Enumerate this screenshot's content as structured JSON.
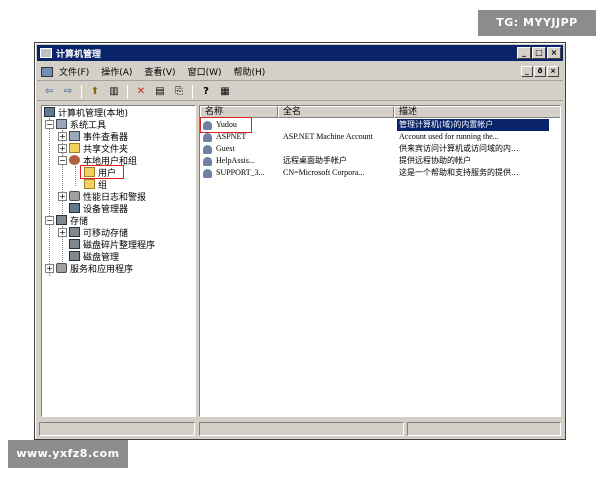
{
  "watermark_top": "TG: MYYJJPP",
  "watermark_bottom": "www.yxfz8.com",
  "window": {
    "title": "计算机管理",
    "buttons": [
      "_",
      "□",
      "×"
    ]
  },
  "menu": {
    "items": [
      "文件(F)",
      "操作(A)",
      "查看(V)",
      "窗口(W)",
      "帮助(H)"
    ],
    "mdi_buttons": [
      "_",
      "ð",
      "×"
    ]
  },
  "toolbar": {
    "icons": [
      "back-arrow-icon",
      "forward-arrow-icon",
      "up-folder-icon",
      "show-tree-icon",
      "delete-icon",
      "properties-icon",
      "export-icon",
      "help-icon",
      "console-icon"
    ],
    "glyphs": [
      "⇦",
      "⇨",
      "⬆",
      "▥",
      "✕",
      "▤",
      "⎘",
      "?",
      "▦"
    ]
  },
  "tree": {
    "root": "计算机管理(本地)",
    "system_tools": "系统工具",
    "event_viewer": "事件查看器",
    "shared_folders": "共享文件夹",
    "local_users_groups": "本地用户和组",
    "users": "用户",
    "groups": "组",
    "perf_logs": "性能日志和警报",
    "device_manager": "设备管理器",
    "storage": "存储",
    "removable_storage": "可移动存储",
    "defrag": "磁盘碎片整理程序",
    "disk_management": "磁盘管理",
    "services_apps": "服务和应用程序",
    "plus": "+",
    "minus": "−"
  },
  "list": {
    "columns": [
      "名称",
      "全名",
      "描述"
    ],
    "rows": [
      {
        "name": "Yudou",
        "fullname": "",
        "description": "管理计算机(域)的内置帐户"
      },
      {
        "name": "ASPNET",
        "fullname": "ASP.NET Machine Account",
        "description": "Account used for running the..."
      },
      {
        "name": "Guest",
        "fullname": "",
        "description": "供来宾访问计算机或访问域的内..."
      },
      {
        "name": "HelpAssis...",
        "fullname": "远程桌面助手帐户",
        "description": "提供远程协助的帐户"
      },
      {
        "name": "SUPPORT_3...",
        "fullname": "CN=Microsoft Corpora...",
        "description": "这是一个帮助和支持服务的提供..."
      }
    ]
  },
  "colors": {
    "title_bar": "#0a246a",
    "selection": "#0a246a",
    "window_face": "#d4d0c8",
    "highlight_box": "#e02020"
  }
}
